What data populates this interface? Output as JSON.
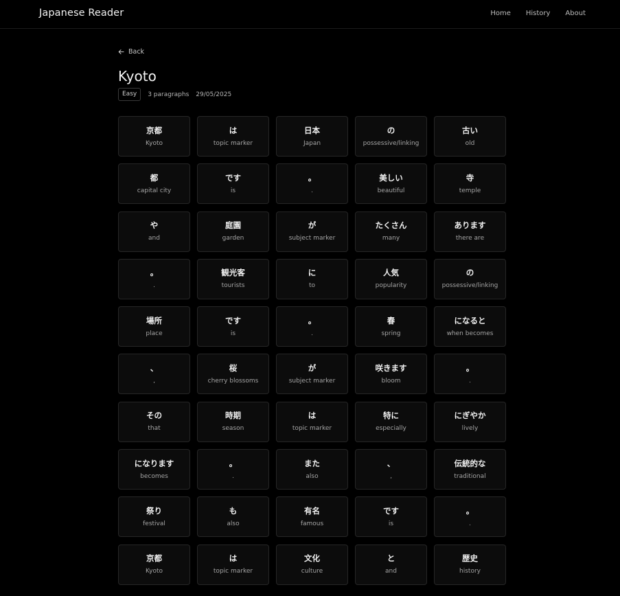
{
  "header": {
    "brand": "Japanese Reader",
    "nav": [
      {
        "label": "Home"
      },
      {
        "label": "History"
      },
      {
        "label": "About"
      }
    ]
  },
  "article": {
    "back_label": "Back",
    "title": "Kyoto",
    "difficulty": "Easy",
    "paragraphs": "3 paragraphs",
    "date": "29/05/2025"
  },
  "icons": {
    "back": "arrow-left-icon"
  },
  "colors": {
    "background": "#000000",
    "card_background": "#0c0c0c",
    "card_border": "#262626",
    "text_primary": "#f0f0f0",
    "text_secondary": "#a6a6a6"
  },
  "words": [
    {
      "jp": "京都",
      "en": "Kyoto"
    },
    {
      "jp": "は",
      "en": "topic marker"
    },
    {
      "jp": "日本",
      "en": "Japan"
    },
    {
      "jp": "の",
      "en": "possessive/linking"
    },
    {
      "jp": "古い",
      "en": "old"
    },
    {
      "jp": "都",
      "en": "capital city"
    },
    {
      "jp": "です",
      "en": "is"
    },
    {
      "jp": "。",
      "en": "."
    },
    {
      "jp": "美しい",
      "en": "beautiful"
    },
    {
      "jp": "寺",
      "en": "temple"
    },
    {
      "jp": "や",
      "en": "and"
    },
    {
      "jp": "庭園",
      "en": "garden"
    },
    {
      "jp": "が",
      "en": "subject marker"
    },
    {
      "jp": "たくさん",
      "en": "many"
    },
    {
      "jp": "あります",
      "en": "there are"
    },
    {
      "jp": "。",
      "en": "."
    },
    {
      "jp": "観光客",
      "en": "tourists"
    },
    {
      "jp": "に",
      "en": "to"
    },
    {
      "jp": "人気",
      "en": "popularity"
    },
    {
      "jp": "の",
      "en": "possessive/linking"
    },
    {
      "jp": "場所",
      "en": "place"
    },
    {
      "jp": "です",
      "en": "is"
    },
    {
      "jp": "。",
      "en": "."
    },
    {
      "jp": "春",
      "en": "spring"
    },
    {
      "jp": "になると",
      "en": "when becomes"
    },
    {
      "jp": "、",
      "en": ","
    },
    {
      "jp": "桜",
      "en": "cherry blossoms"
    },
    {
      "jp": "が",
      "en": "subject marker"
    },
    {
      "jp": "咲きます",
      "en": "bloom"
    },
    {
      "jp": "。",
      "en": "."
    },
    {
      "jp": "その",
      "en": "that"
    },
    {
      "jp": "時期",
      "en": "season"
    },
    {
      "jp": "は",
      "en": "topic marker"
    },
    {
      "jp": "特に",
      "en": "especially"
    },
    {
      "jp": "にぎやか",
      "en": "lively"
    },
    {
      "jp": "になります",
      "en": "becomes"
    },
    {
      "jp": "。",
      "en": "."
    },
    {
      "jp": "また",
      "en": "also"
    },
    {
      "jp": "、",
      "en": ","
    },
    {
      "jp": "伝統的な",
      "en": "traditional"
    },
    {
      "jp": "祭り",
      "en": "festival"
    },
    {
      "jp": "も",
      "en": "also"
    },
    {
      "jp": "有名",
      "en": "famous"
    },
    {
      "jp": "です",
      "en": "is"
    },
    {
      "jp": "。",
      "en": "."
    },
    {
      "jp": "京都",
      "en": "Kyoto"
    },
    {
      "jp": "は",
      "en": "topic marker"
    },
    {
      "jp": "文化",
      "en": "culture"
    },
    {
      "jp": "と",
      "en": "and"
    },
    {
      "jp": "歴史",
      "en": "history"
    }
  ]
}
